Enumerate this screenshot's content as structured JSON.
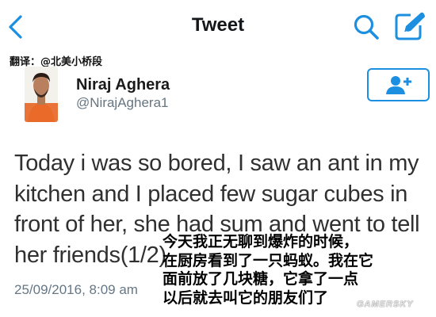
{
  "header": {
    "title": "Tweet",
    "back_icon": "chevron-left-icon",
    "search_icon": "search-icon",
    "compose_icon": "compose-icon",
    "accent_color": "#1d8fe0"
  },
  "credit": "翻译：@北美小桥段",
  "author": {
    "name": "Niraj Aghera",
    "handle": "@NirajAghera1",
    "avatar_icon": "avatar"
  },
  "follow_button": {
    "icon": "add-user-icon"
  },
  "tweet": {
    "lines": [
      "Today i was so bored, I saw an ant in my",
      "kitchen and I placed few sugar cubes in",
      "front of her, she had sum and went to tell",
      "her friends(1/2)"
    ],
    "timestamp": "25/09/2016, 8:09 am"
  },
  "translation": {
    "lines": [
      "今天我正无聊到爆炸的时候，",
      "在厨房看到了一只蚂蚁。我在它",
      "面前放了几块糖，它拿了一点",
      "以后就去叫它的朋友们了"
    ]
  },
  "watermark": "GAMERSKY"
}
